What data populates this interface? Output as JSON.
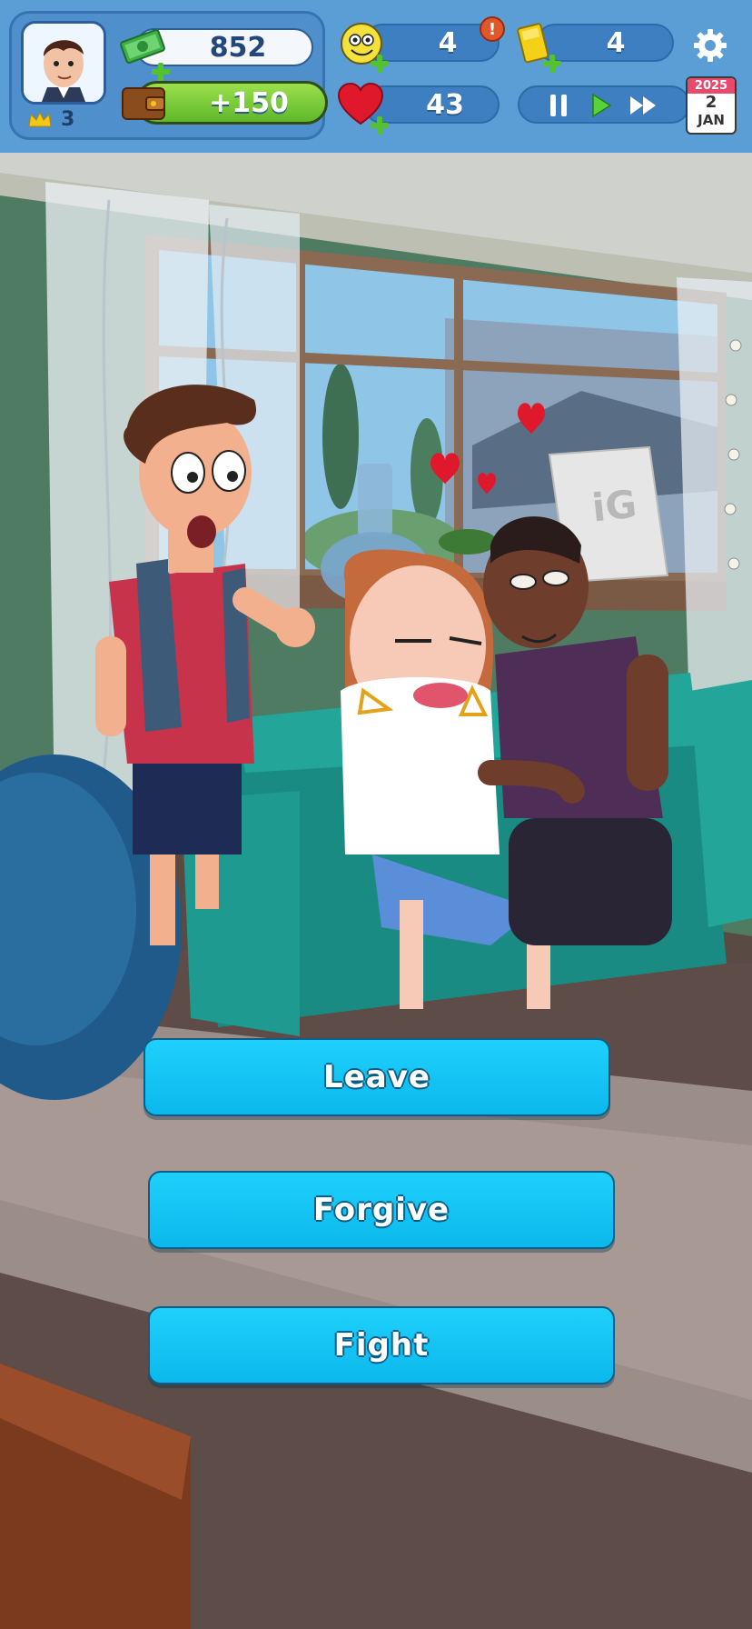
{
  "hud": {
    "level": "3",
    "cash": "852",
    "wallet_bonus": "+150",
    "smiley_count": "4",
    "notification_badge": "!",
    "tickets": "4",
    "hearts": "43",
    "calendar": {
      "year": "2025",
      "day": "2",
      "month": "JAN"
    }
  },
  "choices": {
    "leave": "Leave",
    "forgive": "Forgive",
    "fight": "Fight"
  },
  "scene": {
    "poster_text": "iG"
  },
  "colors": {
    "hud_bg": "#5b9ed6",
    "button": "#12c4f5",
    "heart": "#e0182c"
  }
}
